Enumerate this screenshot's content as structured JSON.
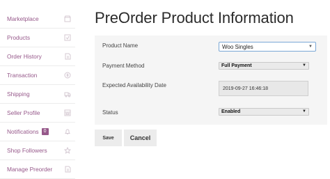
{
  "sidebar": {
    "items": [
      {
        "label": "Marketplace",
        "icon": "store-icon"
      },
      {
        "label": "Products",
        "icon": "box-icon"
      },
      {
        "label": "Order History",
        "icon": "document-icon"
      },
      {
        "label": "Transaction",
        "icon": "dollar-icon"
      },
      {
        "label": "Shipping",
        "icon": "truck-icon"
      },
      {
        "label": "Seller Profile",
        "icon": "profile-card-icon"
      },
      {
        "label": "Notifications",
        "badge": "0",
        "icon": "bell-icon"
      },
      {
        "label": "Shop Followers",
        "icon": "star-icon"
      },
      {
        "label": "Manage Preorder",
        "icon": "document-icon"
      }
    ],
    "accent": "#96588a"
  },
  "main": {
    "title": "PreOrder Product Information",
    "form": {
      "product_name_label": "Product Name",
      "product_name_value": "Woo Singles",
      "payment_method_label": "Payment Method",
      "payment_method_value": "Full Payment",
      "availability_label": "Expected Availability Date",
      "availability_value": "2019-09-27 16:46:18",
      "status_label": "Status",
      "status_value": "Enabled"
    },
    "buttons": {
      "save": "Save",
      "cancel": "Cancel"
    }
  }
}
